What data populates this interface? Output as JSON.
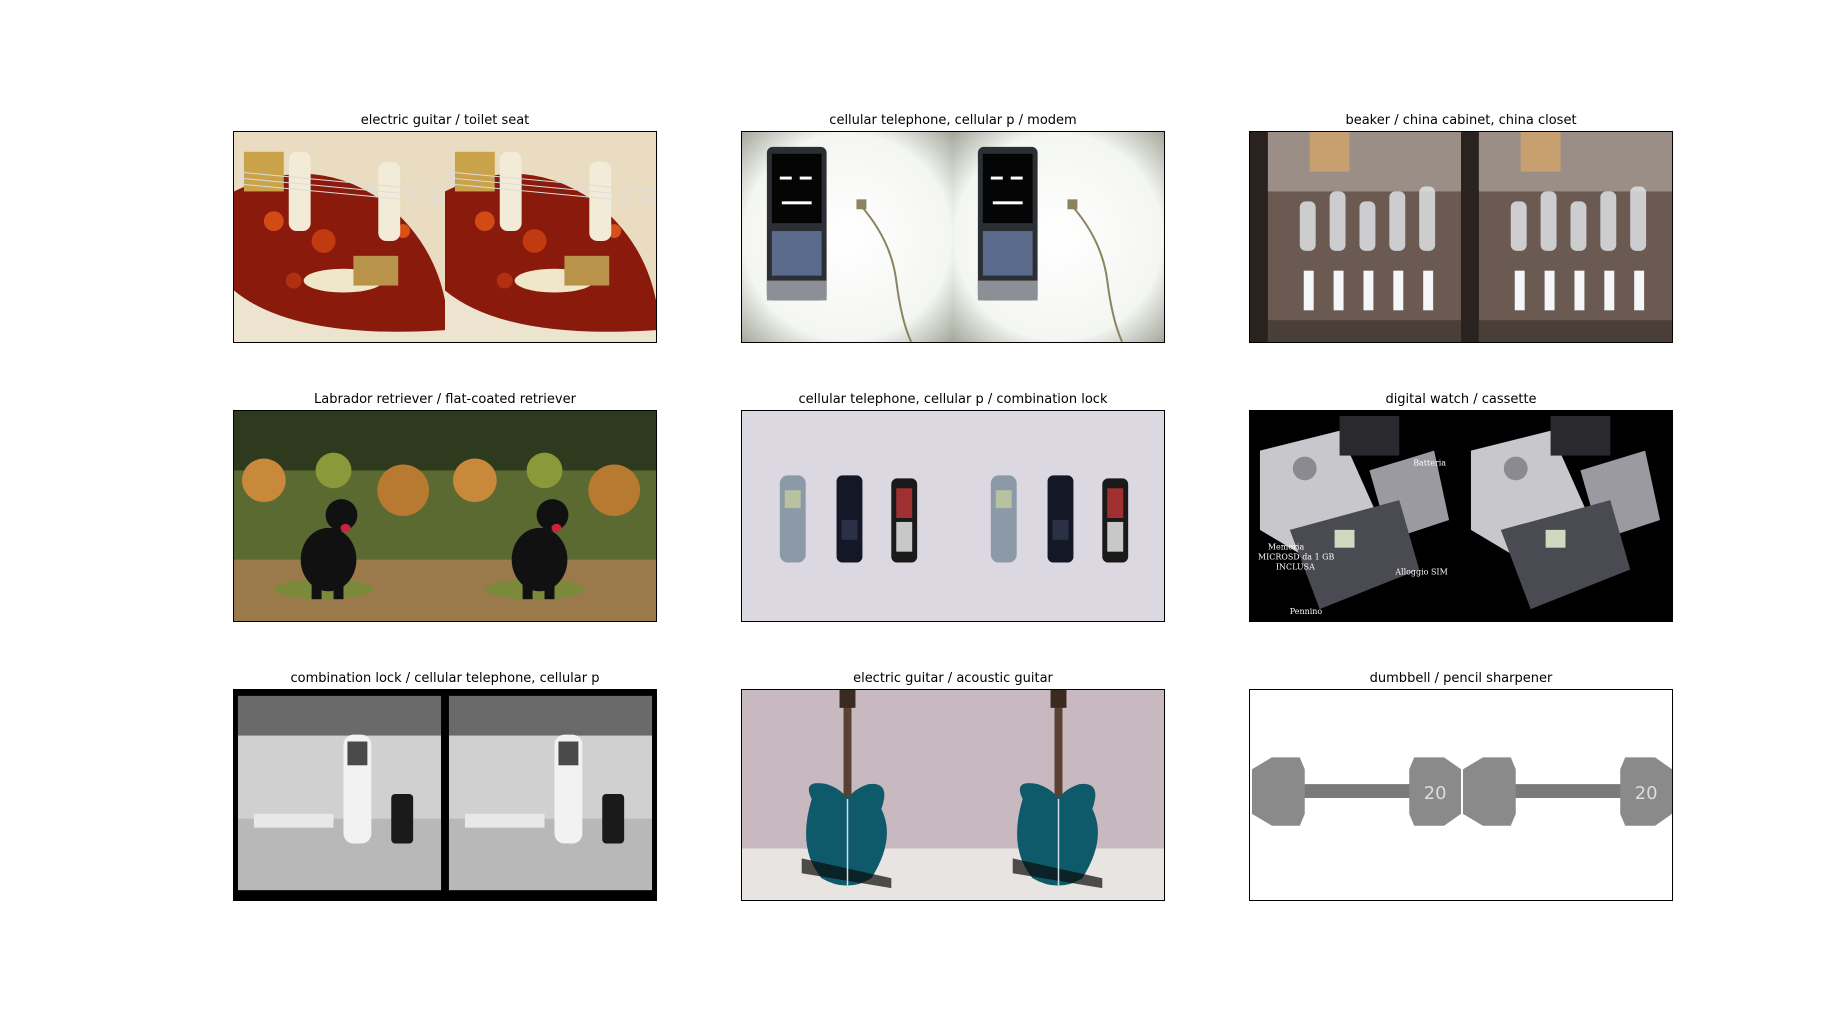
{
  "panels": [
    {
      "title": "electric guitar / toilet seat",
      "image": "electric-guitar-closeup-photo"
    },
    {
      "title": "cellular telephone, cellular p / modem",
      "image": "cellphone-and-cable-photo"
    },
    {
      "title": "beaker / china cabinet, china closet",
      "image": "glass-beakers-photo"
    },
    {
      "title": "Labrador retriever / flat-coated retriever",
      "image": "black-dog-photo"
    },
    {
      "title": "cellular telephone, cellular p / combination lock",
      "image": "three-phones-photo"
    },
    {
      "title": "digital watch / cassette",
      "image": "phone-parts-labeled-photo",
      "labels": [
        "Batteria",
        "Memoria",
        "MICROSD da 1 GB",
        "INCLUSA",
        "Alloggio SIM",
        "Pennino"
      ]
    },
    {
      "title": "combination lock / cellular telephone, cellular p",
      "image": "grayscale-phone-photo"
    },
    {
      "title": "electric guitar / acoustic guitar",
      "image": "teal-guitar-photo"
    },
    {
      "title": "dumbbell / pencil sharpener",
      "image": "dumbbell-photo",
      "labels": [
        "20",
        "20"
      ]
    }
  ]
}
